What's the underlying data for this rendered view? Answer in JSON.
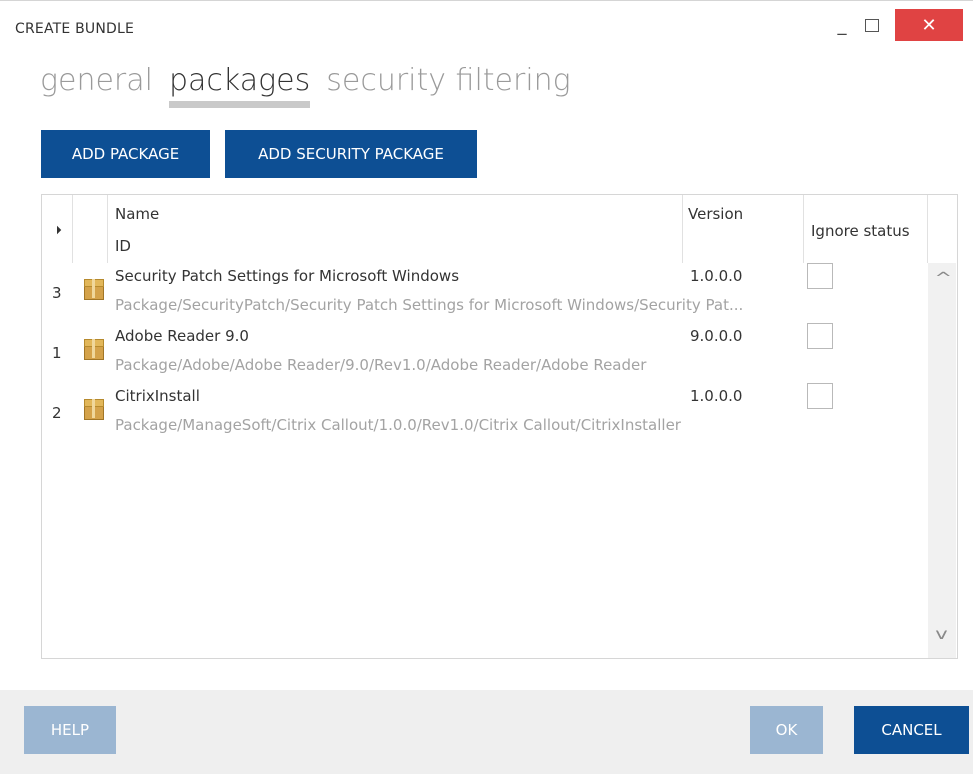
{
  "window": {
    "title": "CREATE BUNDLE",
    "minimize": "_",
    "close": "✕"
  },
  "tabs": [
    "general",
    "packages",
    "security filtering"
  ],
  "buttons": {
    "add_package": "ADD PACKAGE",
    "add_security_package": "ADD SECURITY PACKAGE",
    "help": "HELP",
    "ok": "OK",
    "cancel": "CANCEL"
  },
  "table": {
    "headers": {
      "name": "Name",
      "id": "ID",
      "version": "Version",
      "ignore": "Ignore status"
    },
    "rows": [
      {
        "num": "3",
        "name": "Security Patch Settings for Microsoft Windows",
        "id": "Package/SecurityPatch/Security Patch Settings for Microsoft Windows/Security Pat...",
        "version": "1.0.0.0"
      },
      {
        "num": "1",
        "name": "Adobe Reader 9.0",
        "id": "Package/Adobe/Adobe Reader/9.0/Rev1.0/Adobe Reader/Adobe Reader",
        "version": "9.0.0.0"
      },
      {
        "num": "2",
        "name": "CitrixInstall",
        "id": "Package/ManageSoft/Citrix Callout/1.0.0/Rev1.0/Citrix Callout/CitrixInstaller",
        "version": "1.0.0.0"
      }
    ]
  },
  "scroll": {
    "up": "^",
    "down": "v"
  },
  "colors": {
    "primary": "#0d4f94",
    "disabled": "#9bb6d2",
    "close": "#e04343"
  }
}
